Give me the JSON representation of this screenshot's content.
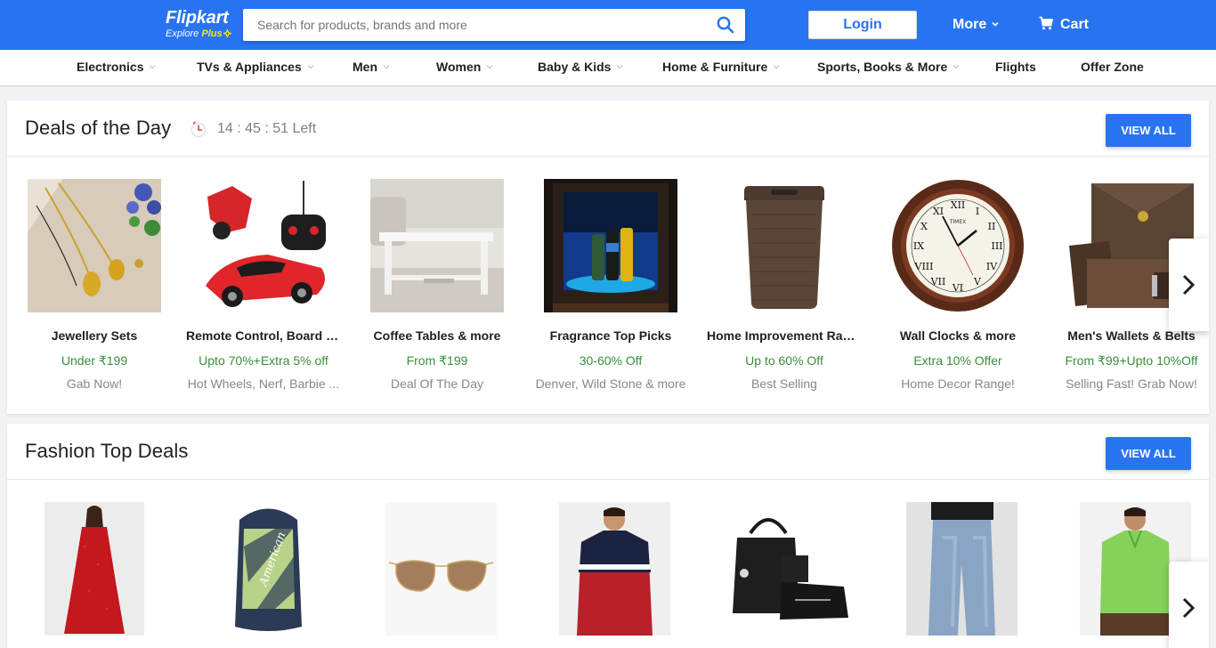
{
  "header": {
    "logo": "Flipkart",
    "logo_sub_prefix": "Explore ",
    "logo_sub_plus": "Plus",
    "search_placeholder": "Search for products, brands and more",
    "login_label": "Login",
    "more_label": "More",
    "cart_label": "Cart"
  },
  "nav": [
    {
      "label": "Electronics",
      "has_dropdown": true
    },
    {
      "label": "TVs & Appliances",
      "has_dropdown": true
    },
    {
      "label": "Men",
      "has_dropdown": true
    },
    {
      "label": "Women",
      "has_dropdown": true
    },
    {
      "label": "Baby & Kids",
      "has_dropdown": true
    },
    {
      "label": "Home & Furniture",
      "has_dropdown": true
    },
    {
      "label": "Sports, Books & More",
      "has_dropdown": true
    },
    {
      "label": "Flights",
      "has_dropdown": false
    },
    {
      "label": "Offer Zone",
      "has_dropdown": false
    }
  ],
  "deals": {
    "title": "Deals of the Day",
    "timer": "14 : 45 : 51 Left",
    "view_all": "VIEW ALL",
    "items": [
      {
        "name": "Jewellery Sets",
        "offer": "Under ₹199",
        "sub": "Gab Now!"
      },
      {
        "name": "Remote Control, Board G...",
        "offer": "Upto 70%+Extra 5% off",
        "sub": "Hot Wheels, Nerf, Barbie ..."
      },
      {
        "name": "Coffee Tables & more",
        "offer": "From ₹199",
        "sub": "Deal Of The Day"
      },
      {
        "name": "Fragrance Top Picks",
        "offer": "30-60% Off",
        "sub": "Denver, Wild Stone & more"
      },
      {
        "name": "Home Improvement Range",
        "offer": "Up to 60% Off",
        "sub": "Best Selling"
      },
      {
        "name": "Wall Clocks & more",
        "offer": "Extra 10% Offer",
        "sub": "Home Decor Range!"
      },
      {
        "name": "Men's Wallets & Belts",
        "offer": "From ₹99+Upto 10%Off",
        "sub": "Selling Fast! Grab Now!"
      }
    ]
  },
  "fashion": {
    "title": "Fashion Top Deals",
    "view_all": "VIEW ALL"
  },
  "colors": {
    "brand_blue": "#2874f0",
    "offer_green": "#388e3c",
    "logo_yellow": "#ffe500"
  },
  "icons": [
    "search-icon",
    "chevron-down-icon",
    "cart-icon",
    "timer-icon",
    "chevron-right-icon"
  ]
}
